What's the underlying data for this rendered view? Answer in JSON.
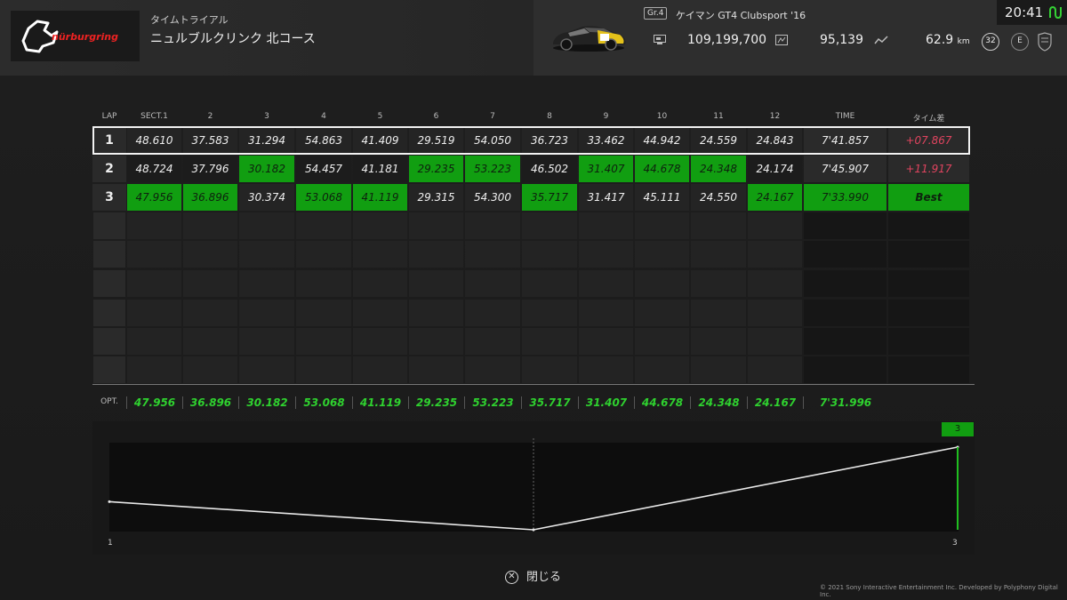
{
  "header": {
    "event_type": "タイムトライアル",
    "track_name": "ニュルブルクリンク 北コース",
    "logo_text": "nürburgring",
    "car_group": "Gr.4",
    "car_name": "ケイマン GT4 Clubsport '16",
    "credits": "109,199,700",
    "mileage_points": "95,139",
    "distance": "62.9",
    "distance_unit": "km",
    "level_badge": "32",
    "license_badge": "E",
    "clock": "20:41"
  },
  "columns": [
    "LAP",
    "SECT.1",
    "2",
    "3",
    "4",
    "5",
    "6",
    "7",
    "8",
    "9",
    "10",
    "11",
    "12",
    "TIME",
    "タイム差"
  ],
  "laps": [
    {
      "lap": "1",
      "sectors": [
        "48.610",
        "37.583",
        "31.294",
        "54.863",
        "41.409",
        "29.519",
        "54.050",
        "36.723",
        "33.462",
        "44.942",
        "24.559",
        "24.843"
      ],
      "best": [
        false,
        false,
        false,
        false,
        false,
        false,
        false,
        false,
        false,
        false,
        false,
        false
      ],
      "time": "7'41.857",
      "diff": "+07.867",
      "is_best": false,
      "selected": true
    },
    {
      "lap": "2",
      "sectors": [
        "48.724",
        "37.796",
        "30.182",
        "54.457",
        "41.181",
        "29.235",
        "53.223",
        "46.502",
        "31.407",
        "44.678",
        "24.348",
        "24.174"
      ],
      "best": [
        false,
        false,
        true,
        false,
        false,
        true,
        true,
        false,
        true,
        true,
        true,
        false
      ],
      "time": "7'45.907",
      "diff": "+11.917",
      "is_best": false,
      "selected": false
    },
    {
      "lap": "3",
      "sectors": [
        "47.956",
        "36.896",
        "30.374",
        "53.068",
        "41.119",
        "29.315",
        "54.300",
        "35.717",
        "31.417",
        "45.111",
        "24.550",
        "24.167"
      ],
      "best": [
        true,
        true,
        false,
        true,
        true,
        false,
        false,
        true,
        false,
        false,
        false,
        true
      ],
      "time": "7'33.990",
      "diff": "Best",
      "is_best": true,
      "selected": false
    }
  ],
  "optimal": {
    "label": "OPT.",
    "sectors": [
      "47.956",
      "36.896",
      "30.182",
      "53.068",
      "41.119",
      "29.235",
      "53.223",
      "35.717",
      "31.407",
      "44.678",
      "24.348",
      "24.167"
    ],
    "time": "7'31.996"
  },
  "chart_data": {
    "type": "line",
    "x": [
      1,
      2,
      3
    ],
    "values": [
      461.857,
      465.907,
      453.99
    ],
    "xlabels": [
      "1",
      "3"
    ],
    "marker_label": "3"
  },
  "footer": {
    "close_label": "閉じる",
    "copyright": "© 2021 Sony Interactive Entertainment Inc. Developed by Polyphony Digital Inc."
  },
  "colors": {
    "best_sector": "#119e11",
    "diff_red": "#e0445f",
    "opt_green": "#2fd12f"
  }
}
